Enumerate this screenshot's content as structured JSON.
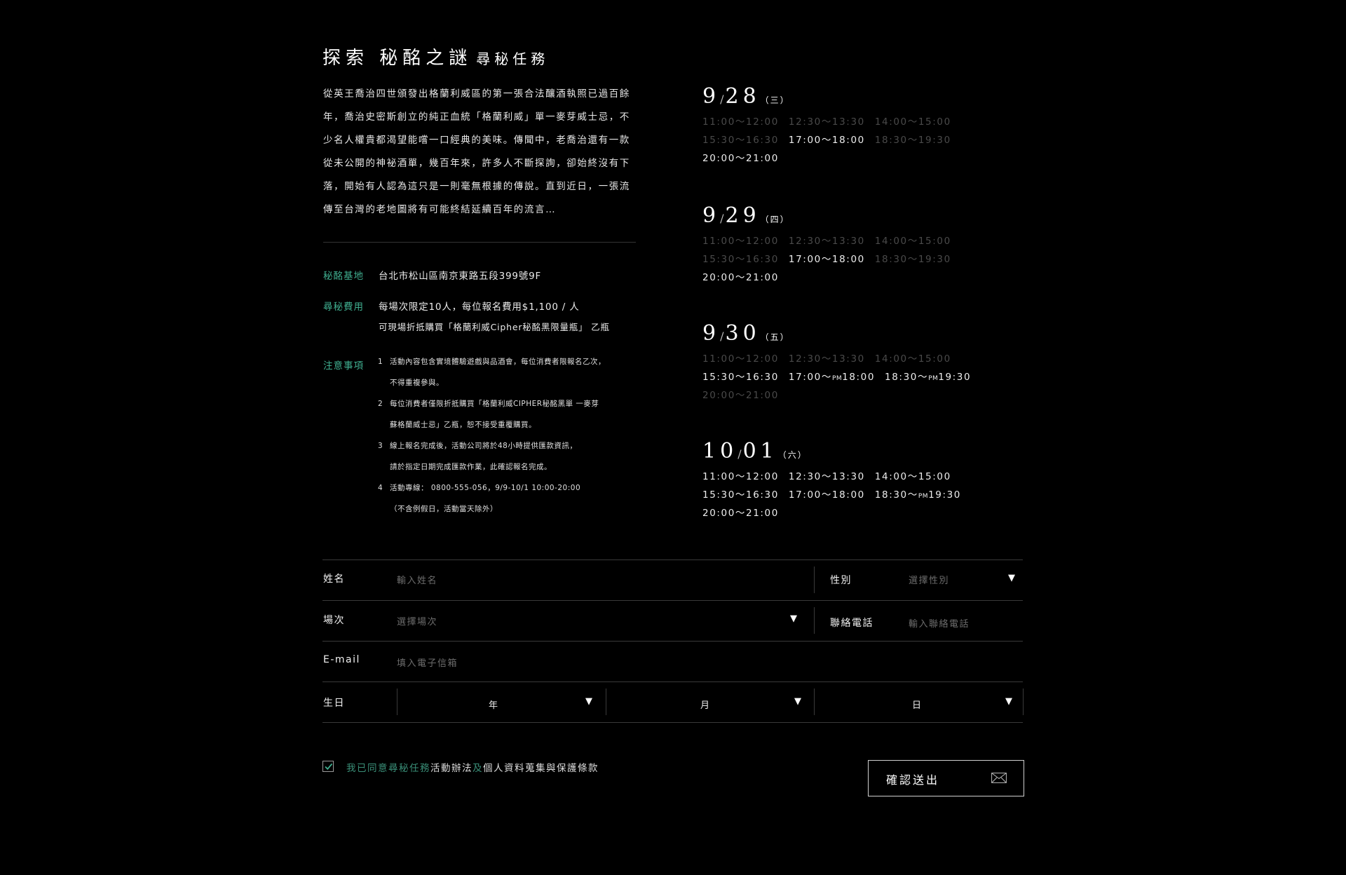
{
  "header": {
    "title": "探索 秘酩之謎",
    "subtitle": "尋秘任務"
  },
  "intro": "從英王喬治四世頒發出格蘭利威區的第一張合法釀酒執照已過百餘年，喬治史密斯創立的純正血統「格蘭利威」單一麥芽威士忌，不少名人權貴都渴望能嚐一口經典的美味。傳聞中，老喬治還有一款從未公開的神祕酒單，幾百年來，許多人不斷探詢，卻始終沒有下落，開始有人認為這只是一則毫無根據的傳說。直到近日，一張流傳至台灣的老地圖將有可能終結延續百年的流言…",
  "info": {
    "base_label": "秘酩基地",
    "base_value": "台北市松山區南京東路五段399號9F",
    "fee_label": "尋秘費用",
    "fee_line1": "每場次限定10人，每位報名費用$1,100 / 人",
    "fee_line2": "可現場折抵購買「格蘭利威Cipher秘酩黑限量瓶」 乙瓶",
    "notes_label": "注意事項",
    "notes": [
      {
        "num": "1",
        "lines": [
          "活動內容包含實境體驗遊戲與品酒會，每位消費者限報名乙次，",
          "不得重複參與。"
        ]
      },
      {
        "num": "2",
        "lines": [
          "每位消費者僅限折抵購買「格蘭利威CIPHER秘酩黑單 一麥芽",
          "蘇格蘭威士忌」乙瓶，恕不接受重覆購買。"
        ]
      },
      {
        "num": "3",
        "lines": [
          "線上報名完成後，活動公司將於48小時提供匯款資訊，",
          "請於指定日期完成匯款作業，此確認報名完成。"
        ]
      },
      {
        "num": "4",
        "lines": [
          "活動專線： 0800-555-056，9/9-10/1  10:00-20:00",
          "（不含例假日，活動當天除外）"
        ]
      }
    ]
  },
  "schedule": [
    {
      "month": "9",
      "day": "28",
      "weekday": "（三）",
      "rows": [
        [
          {
            "t": "11:00～12:00",
            "on": false
          },
          {
            "t": "12:30～13:30",
            "on": false
          },
          {
            "t": "14:00～15:00",
            "on": false
          }
        ],
        [
          {
            "t": "15:30～16:30",
            "on": false
          },
          {
            "t": "17:00～18:00",
            "on": true
          },
          {
            "t": "18:30～19:30",
            "on": false
          }
        ],
        [
          {
            "t": "20:00～21:00",
            "on": true
          }
        ]
      ]
    },
    {
      "month": "9",
      "day": "29",
      "weekday": "（四）",
      "rows": [
        [
          {
            "t": "11:00～12:00",
            "on": false
          },
          {
            "t": "12:30～13:30",
            "on": false
          },
          {
            "t": "14:00～15:00",
            "on": false
          }
        ],
        [
          {
            "t": "15:30～16:30",
            "on": false
          },
          {
            "t": "17:00～18:00",
            "on": true
          },
          {
            "t": "18:30～19:30",
            "on": false
          }
        ],
        [
          {
            "t": "20:00～21:00",
            "on": true
          }
        ]
      ]
    },
    {
      "month": "9",
      "day": "30",
      "weekday": "（五）",
      "rows": [
        [
          {
            "t": "11:00～12:00",
            "on": false
          },
          {
            "t": "12:30～13:30",
            "on": false
          },
          {
            "t": "14:00～15:00",
            "on": false
          }
        ],
        [
          {
            "t": "15:30～16:30",
            "on": true
          },
          {
            "t": "17:00～",
            "pm": "PM",
            "t2": "18:00",
            "on": true
          },
          {
            "t": "18:30～",
            "pm": "PM",
            "t2": "19:30",
            "on": true
          }
        ],
        [
          {
            "t": "20:00～21:00",
            "on": false
          }
        ]
      ]
    },
    {
      "month": "10",
      "day": "01",
      "weekday": "（六）",
      "rows": [
        [
          {
            "t": "11:00～12:00",
            "on": true
          },
          {
            "t": "12:30～13:30",
            "on": true
          },
          {
            "t": "14:00～15:00",
            "on": true
          }
        ],
        [
          {
            "t": "15:30～16:30",
            "on": true
          },
          {
            "t": "17:00～18:00",
            "on": true
          },
          {
            "t": "18:30～",
            "pm": "PM",
            "t2": "19:30",
            "on": true
          }
        ],
        [
          {
            "t": "20:00～21:00",
            "on": true
          }
        ]
      ]
    }
  ],
  "form": {
    "name_label": "姓名",
    "name_placeholder": "輸入姓名",
    "gender_label": "性別",
    "gender_placeholder": "選擇性別",
    "session_label": "場次",
    "session_placeholder": "選擇場次",
    "phone_label": "聯絡電話",
    "phone_placeholder": "輸入聯絡電話",
    "email_label": "E-mail",
    "email_placeholder": "填入電子信箱",
    "birthday_label": "生日",
    "year": "年",
    "month": "月",
    "day": "日"
  },
  "agreement": {
    "prefix": "我已同意尋秘任務",
    "rules": "活動辦法",
    "and": "及",
    "privacy": "個人資料蒐集與保護條款",
    "checked": true
  },
  "submit_label": "確認送出",
  "colors": {
    "background": "#000000",
    "accent": "#3fae8f",
    "muted": "#4a4a4a"
  }
}
